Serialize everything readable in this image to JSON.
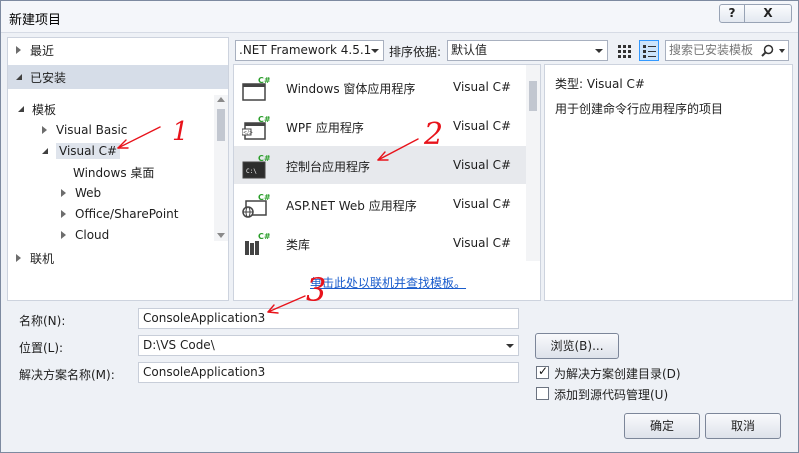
{
  "window": {
    "title": "新建项目",
    "help_label": "?",
    "close_label": "X"
  },
  "left_panel": {
    "recent": "最近",
    "installed": "已安装",
    "tree": [
      {
        "label": "模板",
        "expanded": true
      },
      {
        "label": "Visual Basic",
        "expanded": false
      },
      {
        "label": "Visual C#",
        "expanded": true,
        "selected": true
      },
      {
        "label": "Windows 桌面"
      },
      {
        "label": "Web",
        "expanded": false
      },
      {
        "label": "Office/SharePoint",
        "expanded": false
      },
      {
        "label": "Cloud",
        "expanded": false
      }
    ],
    "online": "联机"
  },
  "toolbar": {
    "framework": ".NET Framework 4.5.1",
    "sort_label": "排序依据:",
    "sort_value": "默认值",
    "search_placeholder": "搜索已安装模板"
  },
  "templates": [
    {
      "name": "Windows 窗体应用程序",
      "lang": "Visual C#",
      "icon": "windows-forms-icon"
    },
    {
      "name": "WPF 应用程序",
      "lang": "Visual C#",
      "icon": "wpf-icon"
    },
    {
      "name": "控制台应用程序",
      "lang": "Visual C#",
      "icon": "console-icon",
      "selected": true
    },
    {
      "name": "ASP.NET Web 应用程序",
      "lang": "Visual C#",
      "icon": "web-app-icon"
    },
    {
      "name": "类库",
      "lang": "Visual C#",
      "icon": "class-library-icon"
    }
  ],
  "online_link": "单击此处以联机并查找模板。",
  "detail": {
    "type_label": "类型:",
    "type_value": "Visual C#",
    "description": "用于创建命令行应用程序的项目"
  },
  "form": {
    "name_label": "名称(N):",
    "name_value": "ConsoleApplication3",
    "location_label": "位置(L):",
    "location_value": "D:\\VS Code\\",
    "solution_label": "解决方案名称(M):",
    "solution_value": "ConsoleApplication3",
    "browse_label": "浏览(B)...",
    "create_dir_label": "为解决方案创建目录(D)",
    "create_dir_checked": true,
    "source_control_label": "添加到源代码管理(U)",
    "source_control_checked": false
  },
  "buttons": {
    "ok": "确定",
    "cancel": "取消"
  },
  "annotations": {
    "one": "1",
    "two": "2",
    "three": "3"
  },
  "colors": {
    "accent": "#3399ff",
    "selection": "#e7e9ed",
    "annotation": "#e8131b",
    "link": "#1a5ccc"
  }
}
